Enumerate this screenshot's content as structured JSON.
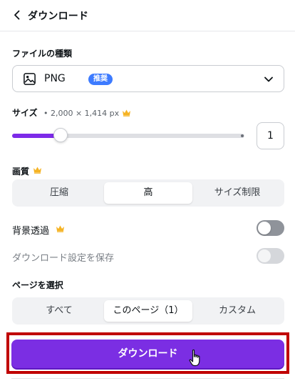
{
  "header": {
    "title": "ダウンロード",
    "back_icon": "chevron-left-icon"
  },
  "file_type": {
    "label": "ファイルの種類",
    "selected": "PNG",
    "badge": "推奨",
    "icon": "image-icon"
  },
  "size": {
    "label": "サイズ",
    "dimensions": "• 2,000 × 1,414 px",
    "multiplier_value": 1,
    "multiplier_display": "1",
    "slider_fraction": 0.21,
    "premium_icon": "crown-icon"
  },
  "quality": {
    "label": "画質",
    "options": [
      "圧縮",
      "高",
      "サイズ制限"
    ],
    "selected": "高"
  },
  "transparent_bg": {
    "label": "背景透過",
    "enabled": false
  },
  "save_settings": {
    "label": "ダウンロード設定を保存",
    "enabled": false
  },
  "pages": {
    "label": "ページを選択",
    "options": [
      "すべて",
      "このページ（1）",
      "カスタム"
    ],
    "selected": "このページ（1）"
  },
  "download_button": {
    "label": "ダウンロード"
  },
  "colors": {
    "accent": "#7d2ae8",
    "badge": "#3d7bff",
    "highlight_border": "#c00000",
    "crown": "#f5b324"
  }
}
